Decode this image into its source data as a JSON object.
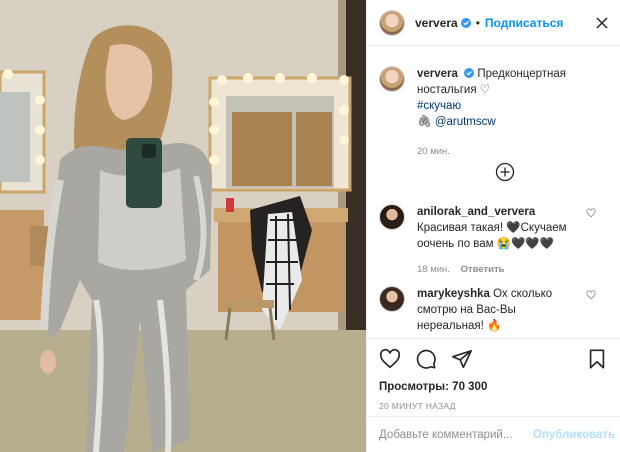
{
  "post": {
    "username": "ververa",
    "follow_label": "Подписаться",
    "separator": "•",
    "caption_username": "ververa",
    "caption_text": "Предконцертная ностальгия ♡",
    "hashtag": "#скучаю",
    "mention_prefix": "🖇",
    "mention": "@arutmscw",
    "caption_time": "20 мин.",
    "views_label": "Просмотры:",
    "views_count": "70 300",
    "posted_ago": "20 МИНУТ НАЗАД"
  },
  "comments": [
    {
      "username": "anilorak_and_ververa",
      "text": "Красивая такая! 🖤Скучаем оочень по вам",
      "emoji": "😭🖤🖤🖤",
      "time": "18 мин.",
      "reply_label": "Ответить"
    },
    {
      "username": "marykeyshka",
      "text": "Ох сколько смотрю на Вас-Вы нереальная!",
      "emoji": "🔥"
    }
  ],
  "input": {
    "placeholder": "Добавьте комментарий...",
    "publish_label": "Опубликовать"
  },
  "colors": {
    "accent": "#0095f6",
    "publish_disabled": "#b2dffc",
    "muted": "#8e8e8e",
    "text": "#262626"
  },
  "icons": [
    "verified-badge-icon",
    "close-icon",
    "load-more-plus-icon",
    "like-icon",
    "comment-icon",
    "share-icon",
    "bookmark-icon"
  ]
}
